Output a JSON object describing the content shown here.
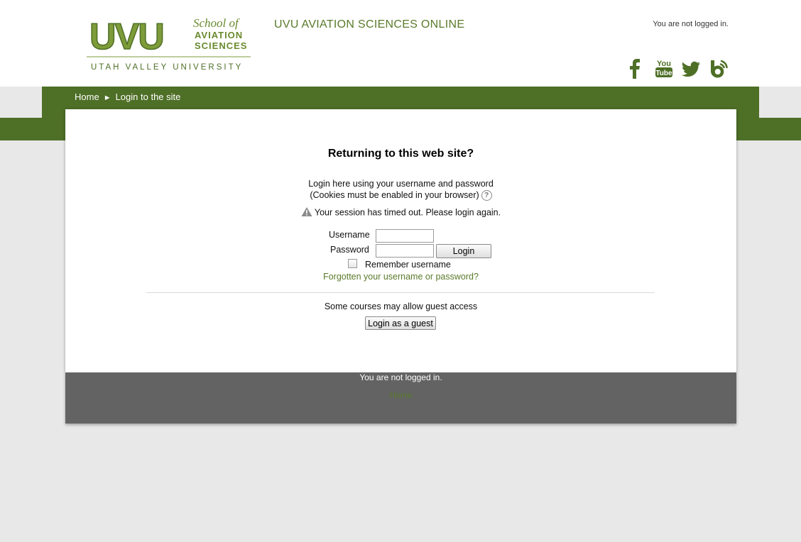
{
  "header": {
    "logo": {
      "letters": "UVU",
      "line1": "School of",
      "line2": "AVIATION",
      "line3": "SCIENCES",
      "university": "UTAH VALLEY UNIVERSITY"
    },
    "site_title": "UVU AVIATION SCIENCES ONLINE",
    "login_status": "You are not logged in.",
    "social": [
      {
        "name": "facebook-icon",
        "label": "f"
      },
      {
        "name": "youtube-icon",
        "label": "You Tube"
      },
      {
        "name": "twitter-icon",
        "label": ""
      },
      {
        "name": "blog-icon",
        "label": "b"
      }
    ]
  },
  "breadcrumb": {
    "home": "Home",
    "separator": "►",
    "current": "Login to the site"
  },
  "login": {
    "heading": "Returning to this web site?",
    "intro_line1": "Login here using your username and password",
    "intro_line2": "(Cookies must be enabled in your browser)",
    "help_icon": "?",
    "timeout_message": "Your session has timed out. Please login again.",
    "username_label": "Username",
    "password_label": "Password",
    "username_value": "",
    "password_value": "",
    "login_button": "Login",
    "remember_label": "Remember username",
    "remember_checked": false,
    "forgot_link": "Forgotten your username or password?",
    "guest_text": "Some courses may allow guest access",
    "guest_button": "Login as a guest"
  },
  "footer": {
    "login_status": "You are not logged in.",
    "home_link": "Home"
  },
  "colors": {
    "brand_green": "#4e6f26",
    "link_green": "#5a7a2a",
    "footer_gray": "#636363",
    "page_background": "#e8e8e8"
  }
}
